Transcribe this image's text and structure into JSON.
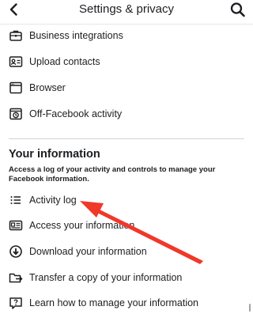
{
  "header": {
    "title": "Settings & privacy",
    "back_icon": "chevron-left-icon",
    "search_icon": "search-icon"
  },
  "top_items": [
    {
      "label": "Business integrations",
      "icon": "briefcase-icon"
    },
    {
      "label": "Upload contacts",
      "icon": "contact-card-icon"
    },
    {
      "label": "Browser",
      "icon": "browser-window-icon"
    },
    {
      "label": "Off-Facebook activity",
      "icon": "off-facebook-activity-icon"
    }
  ],
  "your_information": {
    "title": "Your information",
    "description": "Access a log of your activity and controls to manage your Facebook information.",
    "items": [
      {
        "label": "Activity log",
        "icon": "list-icon"
      },
      {
        "label": "Access your information",
        "icon": "id-card-icon"
      },
      {
        "label": "Download your information",
        "icon": "download-circle-icon"
      },
      {
        "label": "Transfer a copy of your information",
        "icon": "folder-transfer-icon"
      },
      {
        "label": "Learn how to manage your information",
        "icon": "help-bubble-icon"
      }
    ]
  },
  "annotation": {
    "arrow_color": "#f0382b"
  }
}
